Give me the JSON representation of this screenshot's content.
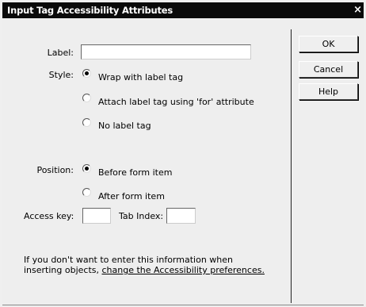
{
  "dialog": {
    "title": "Input Tag Accessibility Attributes",
    "close_glyph": "×"
  },
  "form": {
    "label_caption": "Label:",
    "label_value": "",
    "style_caption": "Style:",
    "style_options": [
      {
        "label": "Wrap with label tag",
        "checked": true
      },
      {
        "label": "Attach label tag using 'for' attribute",
        "checked": false
      },
      {
        "label": "No label tag",
        "checked": false
      }
    ],
    "position_caption": "Position:",
    "position_options": [
      {
        "label": "Before form item",
        "checked": true
      },
      {
        "label": "After form item",
        "checked": false
      }
    ],
    "access_key_caption": "Access key:",
    "access_key_value": "",
    "tab_index_caption": "Tab Index:",
    "tab_index_value": ""
  },
  "buttons": {
    "ok": "OK",
    "cancel": "Cancel",
    "help": "Help"
  },
  "footer": {
    "line1": "If you don't want to enter this information when",
    "line2_prefix": "inserting objects, ",
    "link": "change the Accessibility preferences."
  }
}
